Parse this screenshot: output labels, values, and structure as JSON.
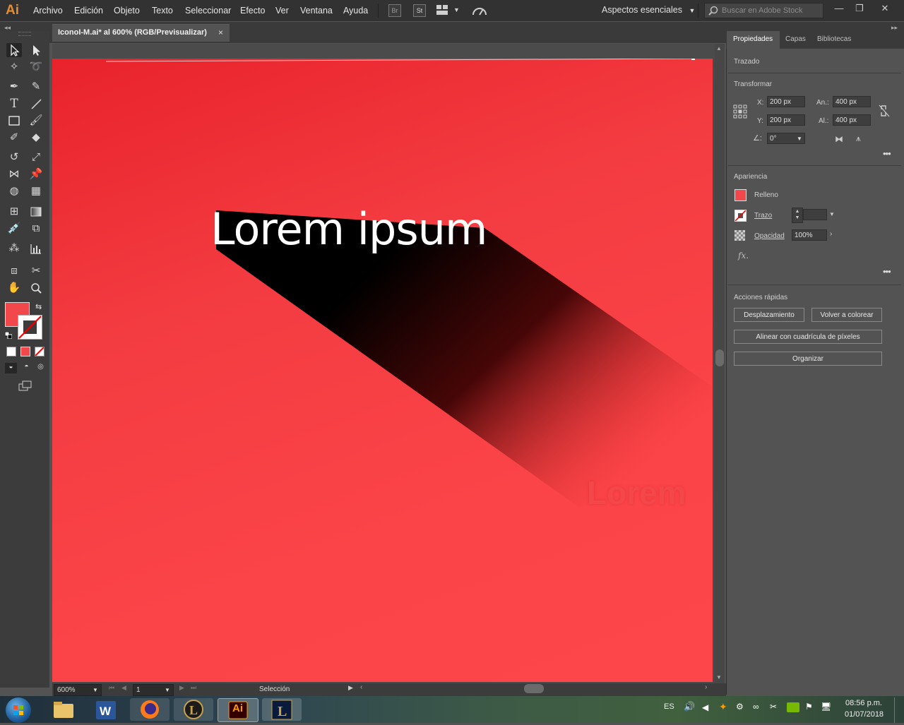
{
  "app": {
    "logo": "Ai",
    "menus": [
      "Archivo",
      "Edición",
      "Objeto",
      "Texto",
      "Seleccionar",
      "Efecto",
      "Ver",
      "Ventana",
      "Ayuda"
    ],
    "bridge_label": "Br",
    "stock_label": "St",
    "workspace": "Aspectos esenciales",
    "search_placeholder": "Buscar en Adobe Stock",
    "window_controls": {
      "minimize": "—",
      "restore": "❐",
      "close": "✕"
    }
  },
  "document": {
    "tab_title": "IconoI-M.ai* al 600% (RGB/Previsualizar)",
    "close_label": "×"
  },
  "artboard": {
    "headline": "Lorem ipsum",
    "ghost_text": "Lorem",
    "colors": {
      "fill": "#fb4448",
      "shadow": "#000000",
      "text": "#ffffff"
    }
  },
  "status": {
    "zoom": "600%",
    "artboard_number": "1",
    "tool_name": "Selección"
  },
  "properties": {
    "tabs": [
      "Propiedades",
      "Capas",
      "Bibliotecas"
    ],
    "object_type": "Trazado",
    "transform": {
      "title": "Transformar",
      "x_label": "X:",
      "x_value": "200 px",
      "y_label": "Y:",
      "y_value": "200 px",
      "w_label": "An.:",
      "w_value": "400 px",
      "h_label": "Al.:",
      "h_value": "400 px",
      "rotate_value": "0°"
    },
    "appearance": {
      "title": "Apariencia",
      "fill_label": "Relleno",
      "fill_color": "#f2474b",
      "stroke_label": "Trazo",
      "opacity_label": "Opacidad",
      "opacity_value": "100%",
      "fx_label": "fx."
    },
    "quick_actions": {
      "title": "Acciones rápidas",
      "offset": "Desplazamiento",
      "recolor": "Volver a colorear",
      "align_pixel": "Alinear con cuadrícula de píxeles",
      "arrange": "Organizar"
    }
  },
  "taskbar": {
    "apps": [
      "file-explorer",
      "word",
      "firefox",
      "league-client",
      "illustrator",
      "league"
    ],
    "ai_label": "Ai",
    "language": "ES",
    "time": "08:56 p.m.",
    "date": "01/07/2018"
  }
}
